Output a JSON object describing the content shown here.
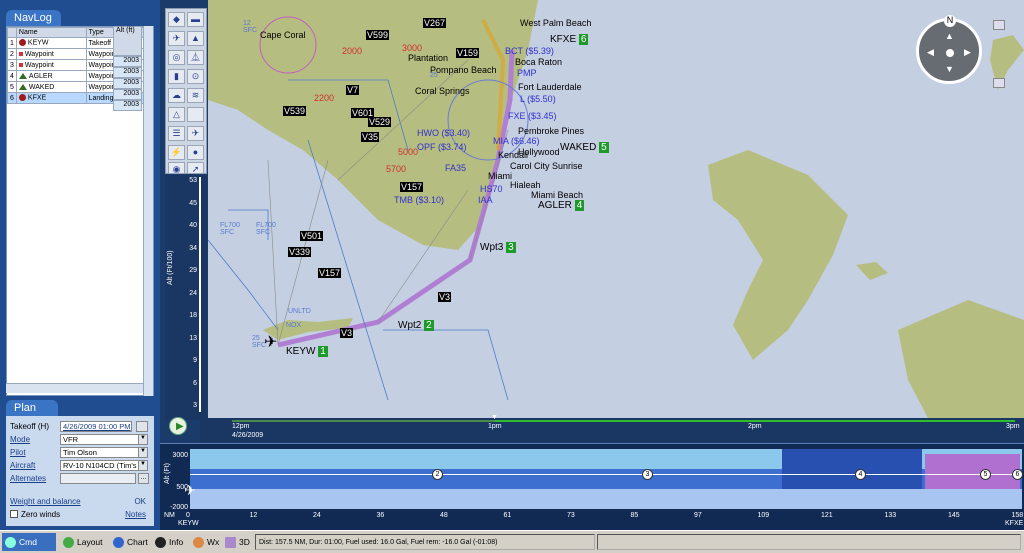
{
  "navlog": {
    "title": "NavLog",
    "columns": [
      "Name",
      "Type",
      "Alt (ft)"
    ],
    "rows": [
      {
        "n": "1",
        "name": "KEYW",
        "type": "Takeoff",
        "icon": "airport",
        "alt": "2003"
      },
      {
        "n": "2",
        "name": "Waypoint",
        "type": "Waypoint",
        "icon": "waypoint",
        "alt": "2003"
      },
      {
        "n": "3",
        "name": "Waypoint",
        "type": "Waypoint",
        "icon": "waypoint",
        "alt": "2003"
      },
      {
        "n": "4",
        "name": "AGLER",
        "type": "Waypoint",
        "icon": "triangle",
        "alt": "2003"
      },
      {
        "n": "5",
        "name": "WAKED",
        "type": "Waypoint",
        "icon": "triangle",
        "alt": "2003"
      },
      {
        "n": "6",
        "name": "KFXE",
        "type": "Landing",
        "icon": "airport",
        "alt": ""
      }
    ]
  },
  "plan": {
    "title": "Plan",
    "takeoff_label": "Takeoff (H)",
    "takeoff": "4/26/2009 01:00 PM",
    "mode_label": "Mode",
    "mode": "VFR",
    "pilot_label": "Pilot",
    "pilot": "Tim Olson",
    "aircraft_label": "Aircraft",
    "aircraft": "RV-10 N104CD (Tim's l",
    "alternates_label": "Alternates",
    "alternates_btn": "...",
    "wb_label": "Weight and balance",
    "ok": "OK",
    "zero_winds": "Zero winds",
    "notes": "Notes"
  },
  "map": {
    "cities": [
      "West Palm Beach",
      "Cape Coral",
      "Plantation",
      "Pompano Beach",
      "Boca Raton",
      "Coral Springs",
      "Fort Lauderdale",
      "Pembroke Pines",
      "Hollywood",
      "Carol City Sunrise",
      "Miami",
      "Hialeah",
      "Miami Beach",
      "Kendall"
    ],
    "airways": [
      "V267",
      "V159",
      "V599",
      "V7",
      "V601",
      "V529",
      "V35",
      "V157",
      "V501",
      "V339",
      "V3",
      "V539"
    ],
    "altitudes": [
      "3000",
      "2000",
      "2200",
      "5000",
      "5700"
    ],
    "waypoints": [
      {
        "name": "KEYW",
        "num": "1"
      },
      {
        "name": "Wpt2",
        "num": "2"
      },
      {
        "name": "Wpt3",
        "num": "3"
      },
      {
        "name": "AGLER",
        "num": "4"
      },
      {
        "name": "WAKED",
        "num": "5"
      },
      {
        "name": "KFXE",
        "num": "6"
      }
    ],
    "airports": [
      "BCT ($5.39)",
      "PMP",
      "L ($5.50)",
      "FXE ($3.45)",
      "HWO ($3.40)",
      "OPF ($3.74)",
      "MIA ($6.46)",
      "TMB ($3.10)",
      "FA35",
      "HS70",
      "IAA"
    ],
    "airspace": [
      "12 SFC",
      "FL700 SFC",
      "FL700 SFC",
      "UNLTD",
      "NOX",
      "25",
      "25 SFC"
    ],
    "alt_ticks": [
      "53",
      "45",
      "40",
      "34",
      "29",
      "24",
      "18",
      "13",
      "9",
      "6",
      "3"
    ],
    "alt_axis_label": "Alt (Ft/100)",
    "time_ticks": [
      "12pm",
      "1pm",
      "2pm",
      "3pm"
    ],
    "time_date": "4/26/2009"
  },
  "profile": {
    "y_ticks": [
      "3000",
      "500",
      "-2000"
    ],
    "y_label": "Alt (Ft)",
    "x_ticks": [
      "0",
      "12",
      "24",
      "36",
      "48",
      "61",
      "73",
      "85",
      "97",
      "109",
      "121",
      "133",
      "145",
      "158"
    ],
    "x_unit": "NM",
    "start": "KEYW",
    "end": "KFXE",
    "markers": [
      "2",
      "3",
      "4",
      "5",
      "6"
    ]
  },
  "status": {
    "tabs": [
      "Cmd",
      "Layout",
      "Chart",
      "Info",
      "Wx",
      "3D"
    ],
    "text": "Dist: 157.5 NM, Dur: 01:00, Fuel used: 16.0 Gal, Fuel rem: -16.0 Gal (-01:08)"
  },
  "colors": {
    "land": "#b5bf7e",
    "water": "#c5cfe2",
    "route": "#b07fd4",
    "panel": "#1f4d8f"
  }
}
